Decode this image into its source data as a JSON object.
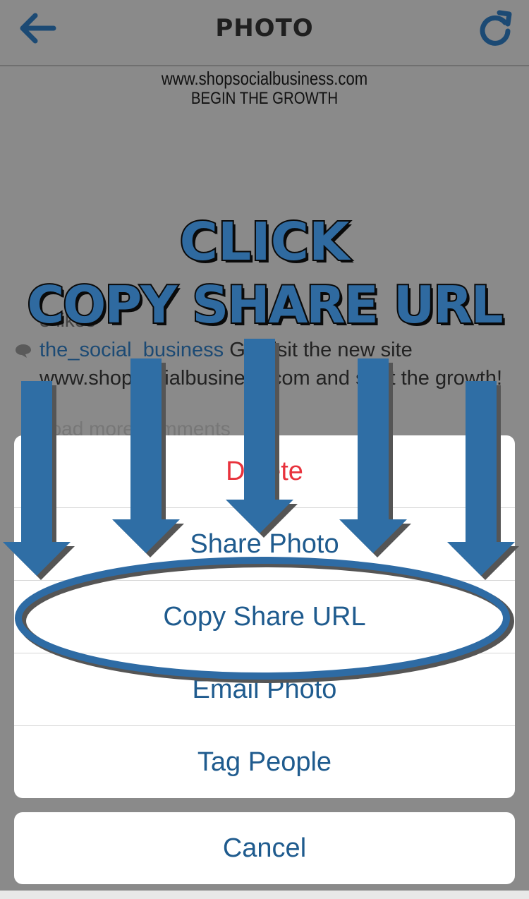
{
  "header": {
    "title": "PHOTO",
    "back_icon": "back-arrow-icon",
    "refresh_icon": "refresh-icon"
  },
  "photo": {
    "site": "www.shopsocialbusiness.com",
    "tagline": "BEGIN THE GROWTH"
  },
  "post": {
    "likes": "3 likes",
    "username": "the_social_business",
    "caption": " Go visit the new site www.shopsocialbusiness.com and start the growth!",
    "more": "Load more comments"
  },
  "overlay": {
    "line1": "CLICK",
    "line2": "COPY SHARE URL",
    "arrow_color": "#2f6ea5",
    "circle_color": "#2e6ba4"
  },
  "action_sheet": {
    "items": [
      {
        "label": "Delete",
        "style": "destructive"
      },
      {
        "label": "Share Photo",
        "style": "default"
      },
      {
        "label": "Copy Share URL",
        "style": "default"
      },
      {
        "label": "Email Photo",
        "style": "default"
      },
      {
        "label": "Tag People",
        "style": "default"
      }
    ],
    "cancel": "Cancel"
  },
  "colors": {
    "accent": "#1f5b8e",
    "destructive": "#e8323c",
    "dim": "#8a8a8a"
  }
}
